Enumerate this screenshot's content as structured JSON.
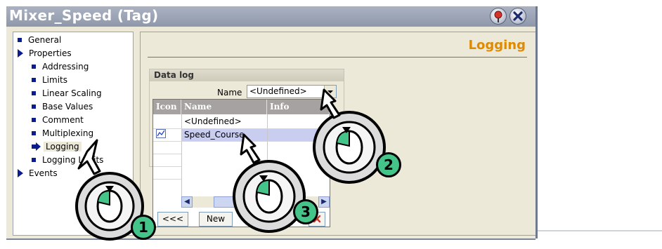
{
  "window": {
    "title": "Mixer_Speed (Tag)"
  },
  "title_buttons": {
    "help": "help-pin-icon",
    "close": "close-icon"
  },
  "tree": {
    "items": [
      {
        "label": "General",
        "marker": "bullet"
      },
      {
        "label": "Properties",
        "marker": "triangle"
      },
      {
        "label": "Addressing",
        "marker": "bullet"
      },
      {
        "label": "Limits",
        "marker": "bullet"
      },
      {
        "label": "Linear Scaling",
        "marker": "bullet"
      },
      {
        "label": "Base Values",
        "marker": "bullet"
      },
      {
        "label": "Comment",
        "marker": "bullet"
      },
      {
        "label": "Multiplexing",
        "marker": "bullet"
      },
      {
        "label": "Logging",
        "marker": "arrow",
        "selected": true
      },
      {
        "label": "Logging Limits",
        "marker": "bullet"
      },
      {
        "label": "Events",
        "marker": "triangle"
      }
    ]
  },
  "panel": {
    "heading": "Logging",
    "datalog": {
      "header": "Data log",
      "name_label": "Name",
      "name_value": "<Undefined>"
    }
  },
  "dropdown": {
    "columns": [
      "Icon",
      "Name",
      "Info"
    ],
    "rows": [
      {
        "icon": "",
        "name": "<Undefined>",
        "info": ""
      },
      {
        "icon": "trend-icon",
        "name": "Speed_Course",
        "info": ""
      }
    ],
    "buttons": {
      "back": "<<<",
      "new": "New"
    }
  },
  "callouts": [
    "1",
    "2",
    "3"
  ],
  "colors": {
    "accent": "#e08a00",
    "callout": "#44c489",
    "title_text": "#ffffff"
  }
}
